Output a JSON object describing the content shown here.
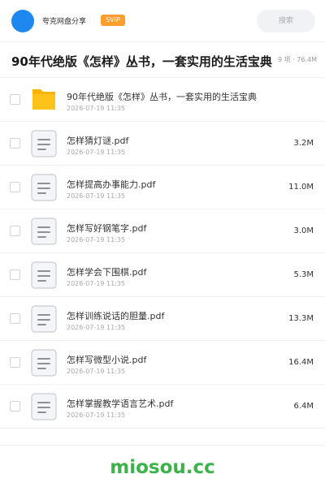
{
  "header": {
    "user_name": "夸克网盘分享",
    "badge": "SVIP",
    "search_placeholder": "搜索"
  },
  "folder": {
    "title": "90年代绝版《怎样》丛书，一套实用的生活宝典",
    "meta": "9 项 · 76.4M"
  },
  "items": [
    {
      "type": "folder-icon",
      "name": "90年代绝版《怎样》丛书，一套实用的生活宝典",
      "date": "2026-07-19 11:35",
      "size": ""
    },
    {
      "type": "document-icon",
      "name": "怎样猜灯谜.pdf",
      "date": "2026-07-19 11:35",
      "size": "3.2M"
    },
    {
      "type": "document-icon",
      "name": "怎样提高办事能力.pdf",
      "date": "2026-07-19 11:35",
      "size": "11.0M"
    },
    {
      "type": "document-icon",
      "name": "怎样写好钢笔字.pdf",
      "date": "2026-07-19 11:35",
      "size": "3.0M"
    },
    {
      "type": "document-icon",
      "name": "怎样学会下围棋.pdf",
      "date": "2026-07-19 11:35",
      "size": "5.3M"
    },
    {
      "type": "document-icon",
      "name": "怎样训练说话的胆量.pdf",
      "date": "2026-07-19 11:35",
      "size": "13.3M"
    },
    {
      "type": "document-icon",
      "name": "怎样写微型小说.pdf",
      "date": "2026-07-19 11:35",
      "size": "16.4M"
    },
    {
      "type": "document-icon",
      "name": "怎样掌握教学语言艺术.pdf",
      "date": "2026-07-19 11:35",
      "size": "6.4M"
    }
  ],
  "footer": {
    "watermark": "miosou.cc"
  },
  "colors": {
    "avatar": "#1e88f0",
    "badge": "#ff9d2f",
    "folder": "#ffc21a",
    "watermark": "#3cb24a"
  }
}
